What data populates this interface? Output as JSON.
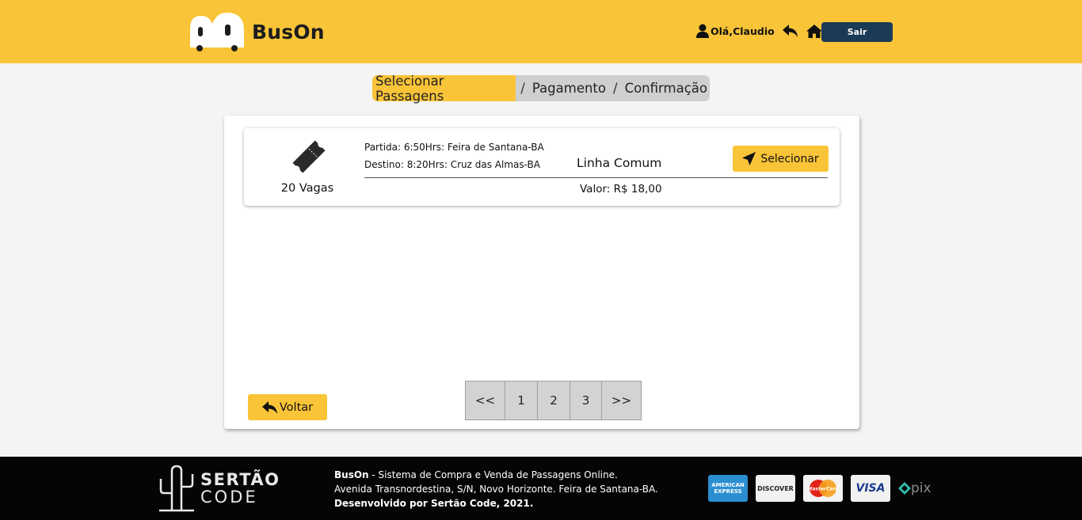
{
  "header": {
    "brand": "BusOn",
    "greeting": "Olá,Claudio",
    "logout_label": "Sair",
    "icons": [
      "user-icon",
      "reply-icon",
      "home-icon"
    ],
    "accent_color": "#f9c438"
  },
  "breadcrumb": {
    "steps": [
      "Selecionar Passagens",
      "Pagamento",
      "Confirmação"
    ],
    "separator": "/",
    "active_index": 0
  },
  "trip": {
    "seats": "20 Vagas",
    "departure": "Partida: 6:50Hrs: Feira de Santana-BA",
    "destination": "Destino: 8:20Hrs: Cruz das Almas-BA",
    "line": "Linha Comum",
    "price": "Valor: R$ 18,00",
    "select_label": "Selecionar",
    "icon": "ticket-icon"
  },
  "back_label": "Voltar",
  "pagination": [
    "<<",
    "1",
    "2",
    "3",
    ">>"
  ],
  "footer": {
    "logo_line1": "SERTÃO",
    "logo_line2": "CODE",
    "brand": "BusOn",
    "description": " - Sistema de Compra e Venda de Passagens Online.",
    "address": "Avenida Transnordestina, S/N, Novo Horizonte. Feira de Santana-BA.",
    "credits": "Desenvolvido por Sertão Code, 2021.",
    "payment_methods": {
      "amex": "AMERICAN EXPRESS",
      "discover": "DISCOVER",
      "mastercard": "MasterCard",
      "visa": "VISA",
      "pix": "pix"
    }
  }
}
